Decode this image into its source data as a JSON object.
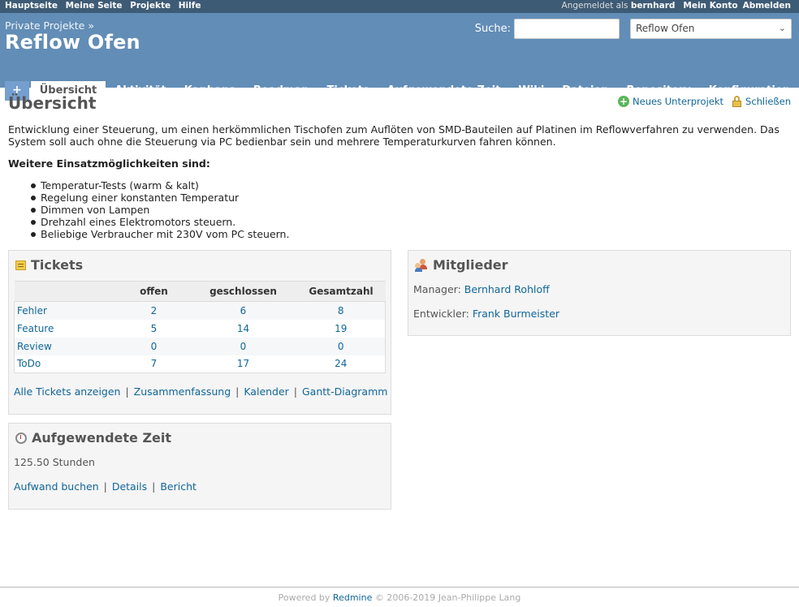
{
  "top_menu": {
    "left": [
      "Hauptseite",
      "Meine Seite",
      "Projekte",
      "Hilfe"
    ],
    "logged_prefix": "Angemeldet als",
    "user": "bernhard",
    "account": "Mein Konto",
    "logout": "Abmelden"
  },
  "header": {
    "breadcrumb": "Private Projekte »",
    "title": "Reflow Ofen",
    "search_label": "Suche:",
    "search_value": "",
    "project_jump": "Reflow Ofen"
  },
  "main_menu": {
    "new": "+",
    "tabs": [
      "Übersicht",
      "Aktivität",
      "Kanbans",
      "Roadmap",
      "Tickets",
      "Aufgewendete Zeit",
      "Wiki",
      "Dateien",
      "Repository",
      "Konfiguration"
    ]
  },
  "content": {
    "title": "Übersicht",
    "actions": {
      "new_subproject": "Neues Unterprojekt",
      "close": "Schließen"
    },
    "description": "Entwicklung einer Steuerung, um einen herkömmlichen Tischofen zum Auflöten von SMD-Bauteilen auf Platinen im Reflowverfahren zu verwenden. Das System soll auch ohne die Steuerung via PC bedienbar sein und mehrere Temperaturkurven fahren können.",
    "uses_heading": "Weitere Einsatzmöglichkeiten sind:",
    "uses": [
      "Temperatur-Tests (warm & kalt)",
      "Regelung einer konstanten Temperatur",
      "Dimmen von Lampen",
      "Drehzahl eines Elektromotors steuern.",
      "Beliebige Verbraucher mit 230V vom PC steuern."
    ]
  },
  "tickets": {
    "title": "Tickets",
    "columns": [
      "",
      "offen",
      "geschlossen",
      "Gesamtzahl"
    ],
    "rows": [
      {
        "name": "Fehler",
        "open": "2",
        "closed": "6",
        "total": "8"
      },
      {
        "name": "Feature",
        "open": "5",
        "closed": "14",
        "total": "19"
      },
      {
        "name": "Review",
        "open": "0",
        "closed": "0",
        "total": "0"
      },
      {
        "name": "ToDo",
        "open": "7",
        "closed": "17",
        "total": "24"
      }
    ],
    "links": [
      "Alle Tickets anzeigen",
      "Zusammenfassung",
      "Kalender",
      "Gantt-Diagramm"
    ]
  },
  "members": {
    "title": "Mitglieder",
    "manager_label": "Manager:",
    "manager": "Bernhard Rohloff",
    "dev_label": "Entwickler:",
    "dev": "Frank Burmeister"
  },
  "time": {
    "title": "Aufgewendete Zeit",
    "hours": "125.50 Stunden",
    "links": [
      "Aufwand buchen",
      "Details",
      "Bericht"
    ]
  },
  "footer": {
    "powered": "Powered by",
    "link": "Redmine",
    "copyright": "© 2006-2019 Jean-Philippe Lang"
  }
}
